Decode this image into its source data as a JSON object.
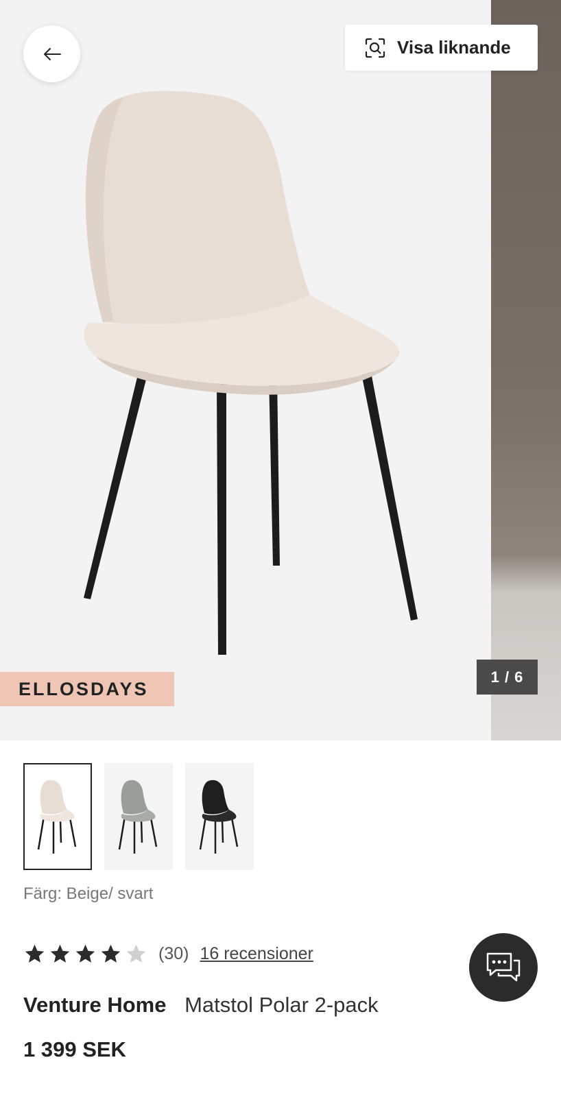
{
  "gallery": {
    "back_icon": "arrow-left-icon",
    "similar_button": {
      "icon": "visual-search-icon",
      "label": "Visa liknande"
    },
    "promo_badge": "ELLOSDAYS",
    "pager": "1 / 6"
  },
  "variants": [
    {
      "color": "#e8ddd5",
      "selected": true
    },
    {
      "color": "#9a9e9b",
      "selected": false
    },
    {
      "color": "#1e1e1e",
      "selected": false
    }
  ],
  "product": {
    "color_label": "Färg: Beige/ svart",
    "rating": {
      "filled_stars": 4,
      "total_stars": 5,
      "count": "(30)",
      "reviews_link": "16 recensioner"
    },
    "brand": "Venture Home",
    "name": "Matstol Polar 2-pack",
    "price": "1 399 SEK"
  },
  "chat": {
    "icon": "chat-bubbles-icon"
  },
  "colors": {
    "accent_badge": "#efc6b6",
    "pager_bg": "#4a4a4a",
    "chat_bg": "#2b2b2b"
  }
}
